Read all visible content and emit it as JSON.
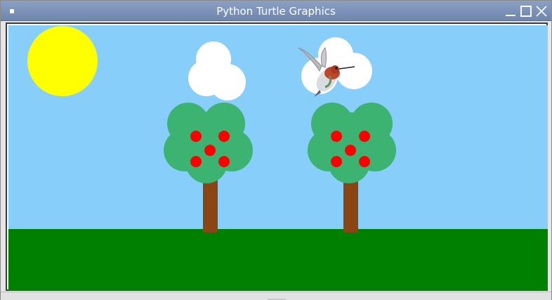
{
  "window": {
    "title": "Python Turtle Graphics"
  },
  "scene": {
    "sky_color": "#87cefa",
    "ground_color": "#008000",
    "sun_color": "#ffff00",
    "cloud_color": "#ffffff",
    "canopy_color": "#3cb371",
    "trunk_color": "#8b4513",
    "apple_color": "#ff0000"
  },
  "icons": {
    "menu": "window-menu-icon",
    "minimize": "minimize-icon",
    "maximize": "maximize-icon",
    "close": "close-icon",
    "bird": "hummingbird-icon"
  }
}
